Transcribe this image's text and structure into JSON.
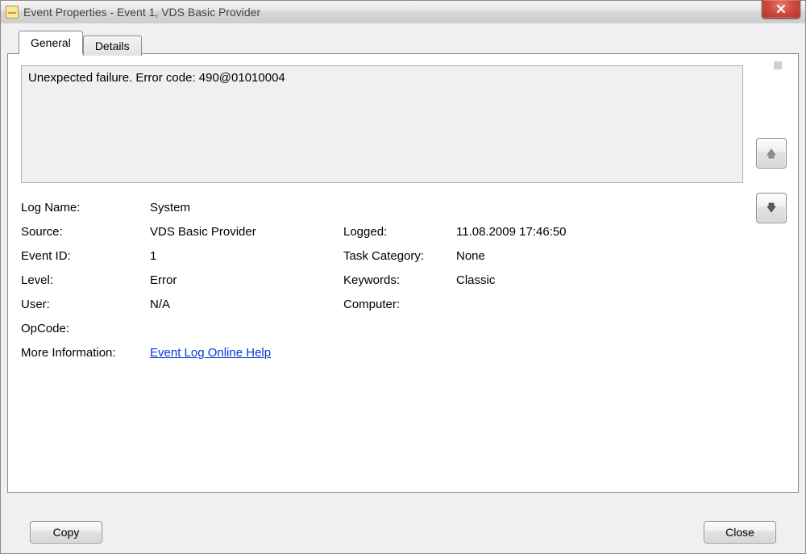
{
  "window": {
    "title": "Event Properties - Event 1, VDS Basic Provider"
  },
  "tabs": {
    "general": "General",
    "details": "Details"
  },
  "description": "Unexpected failure. Error code: 490@01010004",
  "labels": {
    "log_name": "Log Name:",
    "source": "Source:",
    "event_id": "Event ID:",
    "level": "Level:",
    "user": "User:",
    "opcode": "OpCode:",
    "more_info": "More Information:",
    "logged": "Logged:",
    "task_category": "Task Category:",
    "keywords": "Keywords:",
    "computer": "Computer:"
  },
  "values": {
    "log_name": "System",
    "source": "VDS Basic Provider",
    "event_id": "1",
    "level": "Error",
    "user": "N/A",
    "opcode": "",
    "logged": "11.08.2009 17:46:50",
    "task_category": "None",
    "keywords": "Classic",
    "computer": ""
  },
  "links": {
    "online_help": "Event Log Online Help"
  },
  "buttons": {
    "copy": "Copy",
    "close": "Close"
  }
}
